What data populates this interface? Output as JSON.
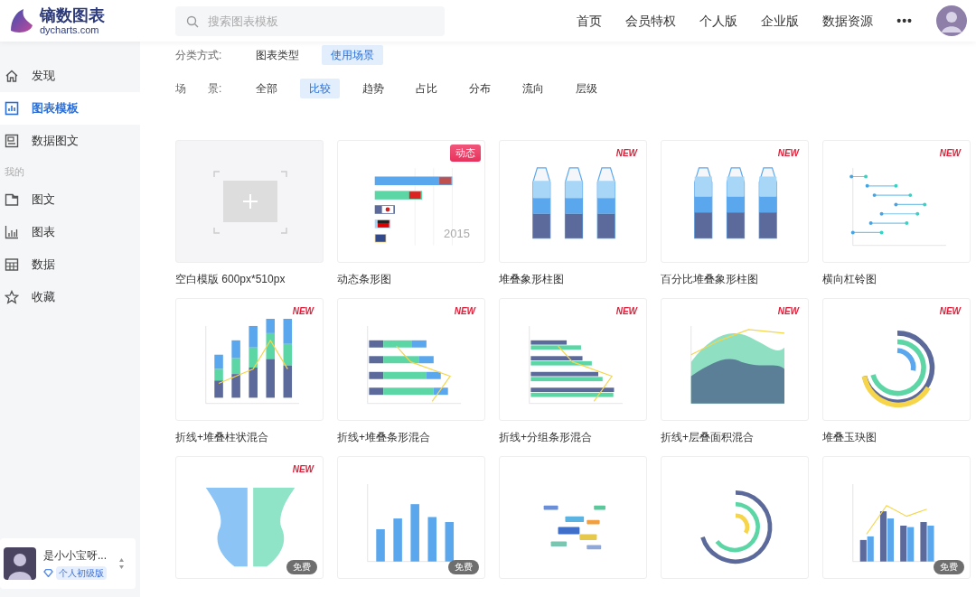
{
  "logo": {
    "name": "镝数图表",
    "domain": "dycharts.com"
  },
  "search": {
    "placeholder": "搜索图表模板"
  },
  "nav": [
    {
      "label": "首页"
    },
    {
      "label": "会员特权"
    },
    {
      "label": "个人版"
    },
    {
      "label": "企业版"
    },
    {
      "label": "数据资源"
    },
    {
      "label": "•••"
    }
  ],
  "sidebar": {
    "items": [
      {
        "label": "发现",
        "selected": false
      },
      {
        "label": "图表模板",
        "selected": true
      },
      {
        "label": "数据图文",
        "selected": false
      }
    ],
    "section": "我的",
    "my_items": [
      {
        "label": "图文",
        "selected": false
      },
      {
        "label": "图表",
        "selected": false
      },
      {
        "label": "数据",
        "selected": false
      },
      {
        "label": "收藏",
        "selected": false
      }
    ],
    "user": {
      "name": "是小小宝呀...",
      "level": "个人初级版"
    }
  },
  "filters": [
    {
      "label": "分类方式:",
      "options": [
        {
          "label": "图表类型",
          "selected": false
        },
        {
          "label": "使用场景",
          "selected": true
        }
      ]
    },
    {
      "label": "场　　景:",
      "options": [
        {
          "label": "全部",
          "selected": false
        },
        {
          "label": "比较",
          "selected": true
        },
        {
          "label": "趋势",
          "selected": false
        },
        {
          "label": "占比",
          "selected": false
        },
        {
          "label": "分布",
          "selected": false
        },
        {
          "label": "流向",
          "selected": false
        },
        {
          "label": "层级",
          "selected": false
        }
      ]
    }
  ],
  "templates": [
    {
      "kind": "blank",
      "title": "空白模版 600px*510px"
    },
    {
      "kind": "bar-race",
      "title": "动态条形图",
      "badge": "动态",
      "caption": "2015"
    },
    {
      "kind": "bottles",
      "title": "堆叠象形柱图",
      "badge": "NEW"
    },
    {
      "kind": "bottles-pct",
      "title": "百分比堆叠象形柱图",
      "badge": "NEW"
    },
    {
      "kind": "dumbbell",
      "title": "横向杠铃图",
      "badge": "NEW"
    },
    {
      "kind": "line-column",
      "title": "折线+堆叠柱状混合",
      "badge": "NEW"
    },
    {
      "kind": "line-bar",
      "title": "折线+堆叠条形混合",
      "badge": "NEW"
    },
    {
      "kind": "line-grouped-bar",
      "title": "折线+分组条形混合",
      "badge": "NEW"
    },
    {
      "kind": "line-area",
      "title": "折线+层叠面积混合",
      "badge": "NEW"
    },
    {
      "kind": "radial-stack",
      "title": "堆叠玉玦图",
      "badge": "NEW"
    },
    {
      "kind": "butterfly",
      "badge": "NEW",
      "free": "免费"
    },
    {
      "kind": "column",
      "free": "免费"
    },
    {
      "kind": "wordcloud"
    },
    {
      "kind": "radial"
    },
    {
      "kind": "column-line",
      "free": "免费"
    }
  ]
}
